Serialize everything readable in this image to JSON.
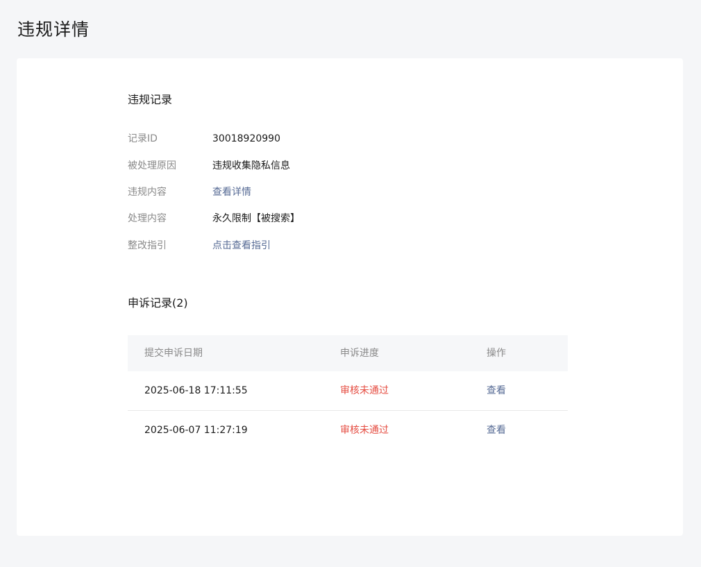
{
  "page": {
    "title": "违规详情"
  },
  "violation": {
    "section_title": "违规记录",
    "rows": [
      {
        "label": "记录ID",
        "value": "30018920990"
      },
      {
        "label": "被处理原因",
        "value": "违规收集隐私信息"
      },
      {
        "label": "违规内容",
        "value": "查看详情"
      },
      {
        "label": "处理内容",
        "value": "永久限制【被搜索】"
      },
      {
        "label": "整改指引",
        "value": "点击查看指引"
      }
    ]
  },
  "appeal": {
    "section_title": "申诉记录(2)",
    "columns": [
      "提交申诉日期",
      "申诉进度",
      "操作"
    ],
    "rows": [
      {
        "date": "2025-06-18 17:11:55",
        "status": "审核未通过",
        "action": "查看"
      },
      {
        "date": "2025-06-07 11:27:19",
        "status": "审核未通过",
        "action": "查看"
      }
    ]
  },
  "colors": {
    "background": "#f5f6f8",
    "card": "#ffffff",
    "link": "#576b95",
    "status_fail": "#e54d42",
    "label": "#8a8a8a"
  }
}
